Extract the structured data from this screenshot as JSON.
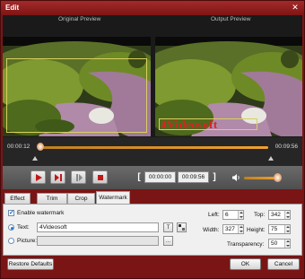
{
  "window": {
    "title": "Edit",
    "close_glyph": "✕"
  },
  "preview": {
    "original_label": "Original Preview",
    "output_label": "Output Preview",
    "watermark_text": "4Videosoft"
  },
  "timeline": {
    "current_time": "00:00:12",
    "total_time": "00:09:56",
    "progress": 1.0,
    "playhead_position": 0.0
  },
  "controls": {
    "start_time": "00:00:00",
    "end_time": "00:09:56",
    "open_bracket": "[",
    "close_bracket": "]",
    "volume": 0.85
  },
  "tabs": [
    {
      "label": "Effect"
    },
    {
      "label": "Trim"
    },
    {
      "label": "Crop"
    },
    {
      "label": "Watermark"
    }
  ],
  "watermark": {
    "enable_label": "Enable watermark",
    "enabled": true,
    "text_label": "Text:",
    "text_value": "4Videosoft",
    "text_icon": "T",
    "picture_label": "Picture:",
    "picture_value": "",
    "browse_label": "...",
    "left_label": "Left:",
    "left_value": "6",
    "top_label": "Top:",
    "top_value": "342",
    "width_label": "Width:",
    "width_value": "327",
    "height_label": "Height:",
    "height_value": "75",
    "transparency_label": "Transparency:",
    "transparency_value": "50"
  },
  "footer": {
    "restore_label": "Restore Defaults",
    "ok_label": "OK",
    "cancel_label": "Cancel"
  },
  "colors": {
    "accent": "#f0a030",
    "frame": "#7a1515",
    "watermark": "#e02020"
  }
}
